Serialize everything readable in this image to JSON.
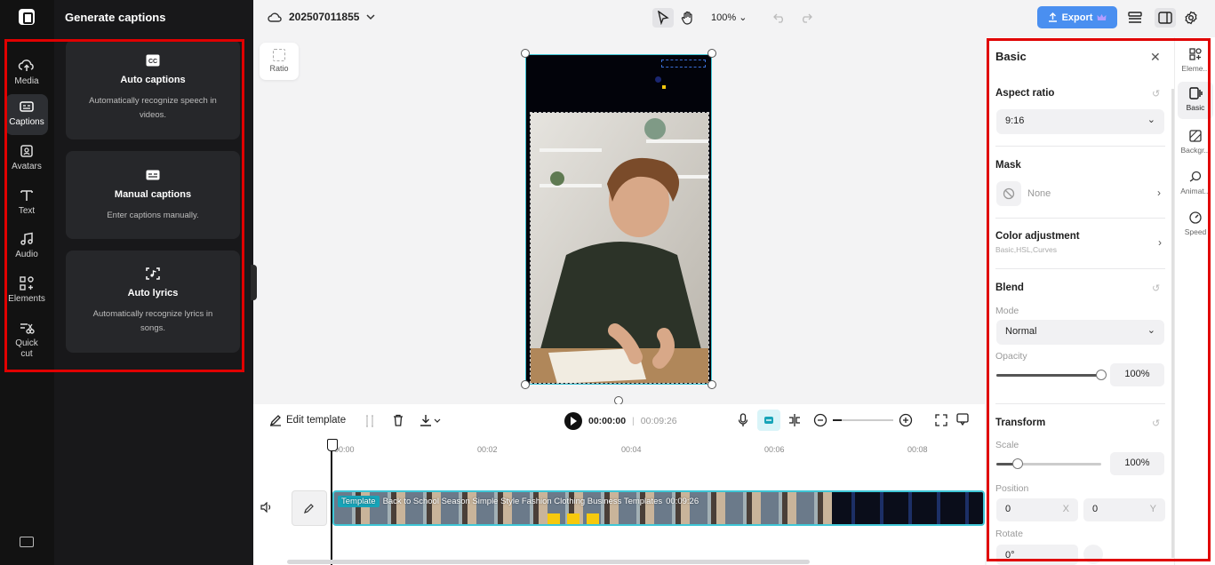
{
  "rail": {
    "items": [
      {
        "label": "Media"
      },
      {
        "label": "Captions"
      },
      {
        "label": "Avatars"
      },
      {
        "label": "Text"
      },
      {
        "label": "Audio"
      },
      {
        "label": "Elements"
      },
      {
        "label": "Quick cut"
      }
    ]
  },
  "panel": {
    "title": "Generate captions",
    "cards": [
      {
        "title": "Auto captions",
        "desc": "Automatically recognize speech in videos."
      },
      {
        "title": "Manual captions",
        "desc": "Enter captions manually."
      },
      {
        "title": "Auto lyrics",
        "desc": "Automatically recognize lyrics in songs."
      }
    ]
  },
  "topbar": {
    "project_name": "202507011855",
    "zoom": "100%",
    "export_label": "Export"
  },
  "canvas": {
    "ratio_label": "Ratio"
  },
  "timeline": {
    "edit_template_label": "Edit template",
    "current_time": "00:00:00",
    "total_time": "00:09:26",
    "ruler_ticks": [
      "00:00",
      "00:02",
      "00:04",
      "00:06",
      "00:08"
    ],
    "track_tag": "Template",
    "track_title": "Back to School Season Simple Style Fashion Clothing Business Templates",
    "track_duration": "00:09:26"
  },
  "props": {
    "title": "Basic",
    "aspect_ratio_label": "Aspect ratio",
    "aspect_ratio_value": "9:16",
    "mask_label": "Mask",
    "mask_value": "None",
    "color_adjustment_label": "Color adjustment",
    "color_adjustment_sub": "Basic,HSL,Curves",
    "blend_label": "Blend",
    "mode_label": "Mode",
    "mode_value": "Normal",
    "opacity_label": "Opacity",
    "opacity_value": "100%",
    "opacity_level": 1.0,
    "transform_label": "Transform",
    "scale_label": "Scale",
    "scale_value": "100%",
    "scale_level": 0.2,
    "position_label": "Position",
    "position_x": "0",
    "position_x_axis": "X",
    "position_y": "0",
    "position_y_axis": "Y",
    "rotate_label": "Rotate",
    "rotate_value": "0°"
  },
  "right_tabs": [
    {
      "label": "Eleme..."
    },
    {
      "label": "Basic"
    },
    {
      "label": "Backgr..."
    },
    {
      "label": "Animat..."
    },
    {
      "label": "Speed"
    }
  ],
  "colors": {
    "accent": "#4a8ff0",
    "selection": "#3fc6d6",
    "highlight_box": "#e00000"
  }
}
